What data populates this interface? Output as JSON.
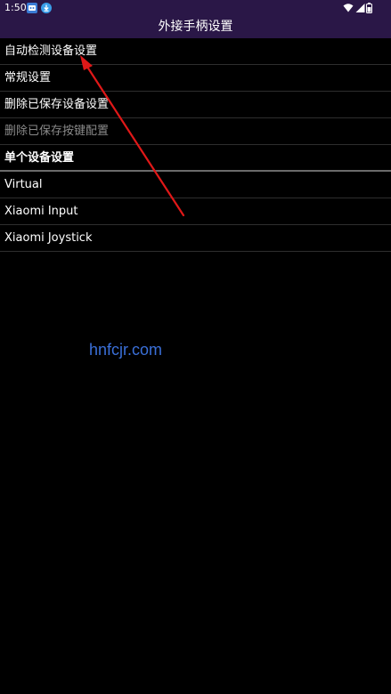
{
  "status_bar": {
    "time": "1:50",
    "icons": [
      "app-notification-icon",
      "download-icon",
      "wifi-icon",
      "signal-icon",
      "battery-icon"
    ]
  },
  "header": {
    "title": "外接手柄设置"
  },
  "settings": {
    "items": [
      {
        "label": "自动检测设备设置",
        "enabled": true
      },
      {
        "label": "常规设置",
        "enabled": true
      },
      {
        "label": "删除已保存设备设置",
        "enabled": true
      },
      {
        "label": "删除已保存按键配置",
        "enabled": false
      }
    ]
  },
  "devices": {
    "section_title": "单个设备设置",
    "items": [
      {
        "label": "Virtual"
      },
      {
        "label": "Xiaomi Input"
      },
      {
        "label": "Xiaomi Joystick"
      }
    ]
  },
  "watermark": {
    "text": "hnfcjr.com"
  },
  "colors": {
    "title_bar_bg": "#2a1747",
    "background": "#000000",
    "disabled_text": "#8a8a8a",
    "watermark": "#3a6fd8",
    "annotation_arrow": "#e01818"
  }
}
